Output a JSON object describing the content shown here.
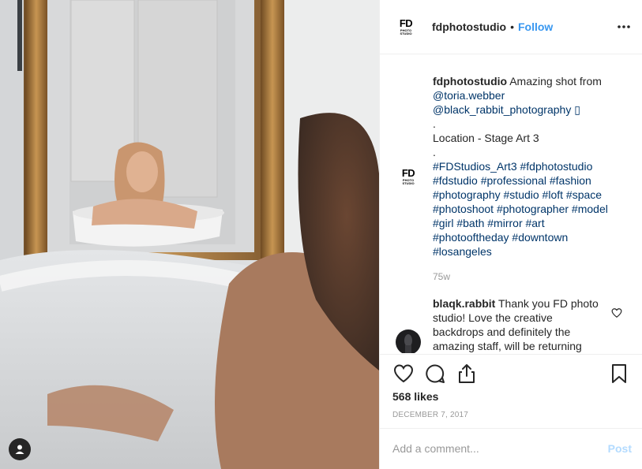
{
  "colors": {
    "link": "#3897f0",
    "hashtag": "#003569",
    "muted": "#999999",
    "post_disabled": "#b3dbff"
  },
  "header": {
    "username": "fdphotostudio",
    "separator": "•",
    "follow_label": "Follow",
    "more_icon": "ellipsis-icon"
  },
  "logo": {
    "top": "FD",
    "bottom_line1": "PHOTO",
    "bottom_line2": "STUDIO"
  },
  "caption": {
    "username": "fdphotostudio",
    "lines": [
      "Amazing shot from",
      "@toria.webber",
      "@black_rabbit_photography ▯",
      ".",
      "Location - Stage Art 3",
      ".",
      "#FDStudios_Art3 #fdphotostudio",
      "#fdstudio #professional #fashion",
      "#photography #studio #loft #space",
      "#photoshoot #photographer #model",
      "#girl #bath #mirror #art",
      "#photooftheday #downtown",
      "#losangeles"
    ],
    "time": "75w"
  },
  "reply": {
    "username": "blaqk.rabbit",
    "lines": [
      "Thank you FD photo",
      "studio! Love the creative",
      "backdrops and definitely the",
      "amazing staff, will be returning"
    ]
  },
  "actions": {
    "like_icon": "heart-icon",
    "comment_icon": "comment-icon",
    "share_icon": "share-icon",
    "save_icon": "bookmark-icon",
    "likes": "568 likes",
    "date": "DECEMBER 7, 2017"
  },
  "add_comment": {
    "placeholder": "Add a comment...",
    "post_label": "Post"
  }
}
